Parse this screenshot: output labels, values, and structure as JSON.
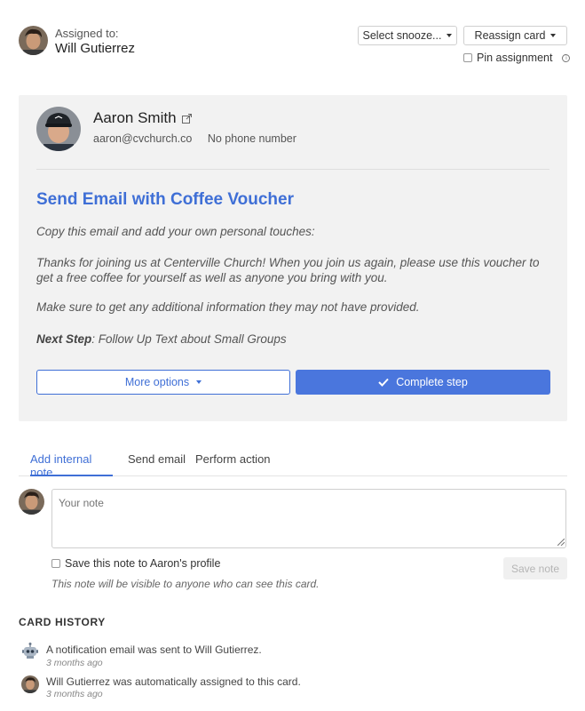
{
  "header": {
    "assigned_label": "Assigned to:",
    "assignee_name": "Will Gutierrez",
    "snooze_label": "Select snooze...",
    "reassign_label": "Reassign card",
    "pin_label": "Pin assignment"
  },
  "card": {
    "contact_name": "Aaron Smith",
    "contact_email": "aaron@cvchurch.co",
    "contact_phone": "No phone number",
    "step_title": "Send Email with Coffee Voucher",
    "instructions": "Copy this email and add your own personal touches:",
    "email_body": "Thanks for joining us at Centerville Church! When you join us again, please use this voucher to get a free coffee for yourself as well as anyone you bring with you.",
    "reminder": "Make sure to get any additional information they may not have provided.",
    "next_step_label": "Next Step",
    "next_step_value": ": Follow Up Text about Small Groups",
    "more_options_label": "More options",
    "complete_label": "Complete step"
  },
  "tabs": [
    {
      "label": "Add internal note",
      "active": true
    },
    {
      "label": "Send email",
      "active": false
    },
    {
      "label": "Perform action",
      "active": false
    }
  ],
  "note": {
    "placeholder": "Your note",
    "save_to_profile_label": "Save this note to Aaron's profile",
    "save_button": "Save note",
    "visibility_hint": "This note will be visible to anyone who can see this card."
  },
  "history": {
    "title": "CARD HISTORY",
    "items": [
      {
        "icon": "robot-icon",
        "text": "A notification email was sent to Will Gutierrez.",
        "time": "3 months ago"
      },
      {
        "icon": "avatar",
        "text": "Will Gutierrez was automatically assigned to this card.",
        "time": "3 months ago"
      }
    ]
  },
  "colors": {
    "accent": "#3f6fd6",
    "primary_button": "#4a76dd",
    "card_background": "#f2f2f2"
  }
}
